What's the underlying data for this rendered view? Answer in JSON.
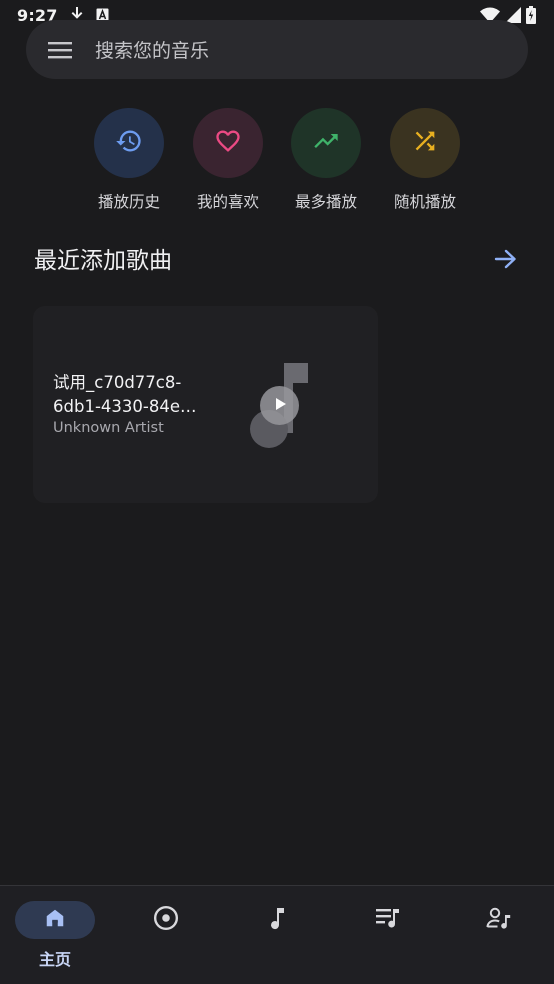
{
  "status_bar": {
    "time": "9:27",
    "icons_left": [
      "download-icon",
      "font-icon"
    ],
    "icons_right": [
      "wifi-icon",
      "signal-icon",
      "battery-charging-icon"
    ]
  },
  "search": {
    "menu_icon": "menu-icon",
    "placeholder": "搜索您的音乐"
  },
  "quick_actions": [
    {
      "label": "播放历史",
      "icon": "history-icon",
      "color": "#6d9cf0",
      "bg": "#24314a"
    },
    {
      "label": "我的喜欢",
      "icon": "heart-icon",
      "color": "#ec4a84",
      "bg": "#3a2430"
    },
    {
      "label": "最多播放",
      "icon": "trending-up-icon",
      "color": "#3fb36a",
      "bg": "#1f3428"
    },
    {
      "label": "随机播放",
      "icon": "shuffle-icon",
      "color": "#e8b020",
      "bg": "#3a3320"
    }
  ],
  "recent_section": {
    "title": "最近添加歌曲",
    "arrow_icon": "arrow-right-icon",
    "accent": "#8fb0f5"
  },
  "songs": [
    {
      "title_line1": "试用_c70d77c8-",
      "title_line2": "6db1-4330-84e…",
      "artist": "Unknown Artist",
      "art_icon": "music-note-icon",
      "play_icon": "play-icon"
    }
  ],
  "bottom_nav": [
    {
      "icon": "home-icon",
      "label": "主页",
      "active": true
    },
    {
      "icon": "album-icon",
      "label": "",
      "active": false
    },
    {
      "icon": "music-note-icon",
      "label": "",
      "active": false
    },
    {
      "icon": "playlist-icon",
      "label": "",
      "active": false
    },
    {
      "icon": "artist-icon",
      "label": "",
      "active": false
    }
  ]
}
